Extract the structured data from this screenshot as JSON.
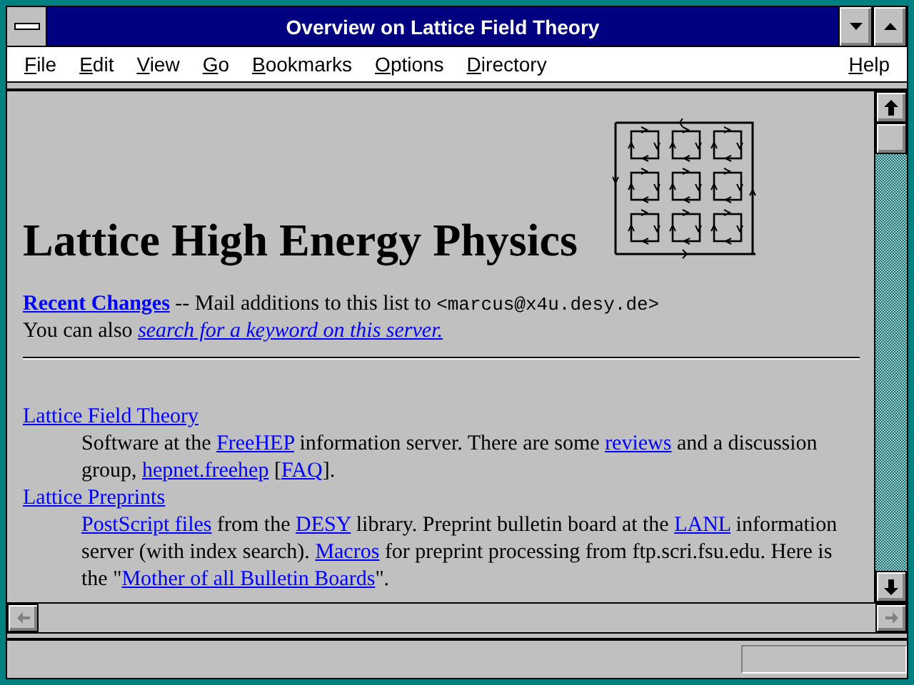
{
  "window": {
    "title": "Overview on Lattice Field Theory"
  },
  "menu": [
    {
      "label": "File"
    },
    {
      "label": "Edit"
    },
    {
      "label": "View"
    },
    {
      "label": "Go"
    },
    {
      "label": "Bookmarks"
    },
    {
      "label": "Options"
    },
    {
      "label": "Directory"
    }
  ],
  "menu_right": [
    {
      "label": "Help"
    }
  ],
  "page": {
    "heading": "Lattice High Energy Physics",
    "intro": [
      [
        {
          "kind": "bold-link",
          "text": "Recent Changes"
        },
        {
          "kind": "text",
          "text": " -- Mail additions to this list to "
        },
        {
          "kind": "mono",
          "text": "<marcus@x4u.desy.de>"
        }
      ],
      [
        {
          "kind": "text",
          "text": "You can also "
        },
        {
          "kind": "italic-link",
          "text": "search for a keyword on this server."
        }
      ]
    ],
    "entries": [
      {
        "title": "Lattice Field Theory",
        "description": [
          {
            "kind": "text",
            "text": "Software at the "
          },
          {
            "kind": "link",
            "text": "FreeHEP"
          },
          {
            "kind": "text",
            "text": " information server. There are some "
          },
          {
            "kind": "link",
            "text": "reviews"
          },
          {
            "kind": "text",
            "text": " and a discussion group, "
          },
          {
            "kind": "link",
            "text": "hepnet.freehep"
          },
          {
            "kind": "text",
            "text": " ["
          },
          {
            "kind": "link",
            "text": "FAQ"
          },
          {
            "kind": "text",
            "text": "]."
          }
        ]
      },
      {
        "title": "Lattice Preprints",
        "description": [
          {
            "kind": "link",
            "text": "PostScript files"
          },
          {
            "kind": "text",
            "text": " from the "
          },
          {
            "kind": "link",
            "text": "DESY"
          },
          {
            "kind": "text",
            "text": " library. Preprint bulletin board at the "
          },
          {
            "kind": "link",
            "text": "LANL"
          },
          {
            "kind": "text",
            "text": " information server (with index search). "
          },
          {
            "kind": "link",
            "text": "Macros"
          },
          {
            "kind": "text",
            "text": " for preprint processing from ftp.scri.fsu.edu. Here is the \""
          },
          {
            "kind": "link",
            "text": "Mother of all Bulletin Boards"
          },
          {
            "kind": "text",
            "text": "\"."
          }
        ]
      }
    ]
  }
}
